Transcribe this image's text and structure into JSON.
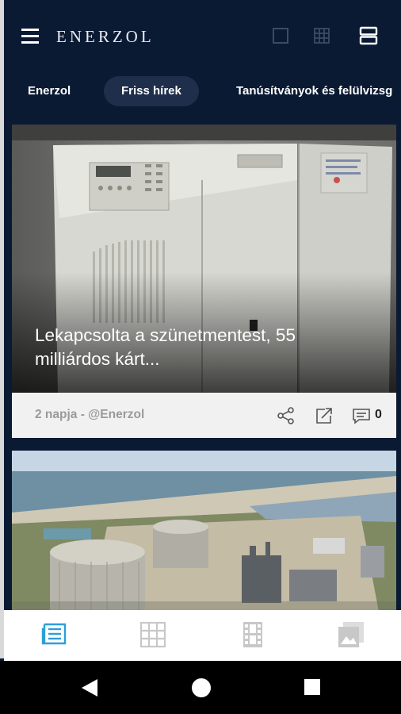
{
  "app": {
    "brand": "ENERZOL"
  },
  "header": {
    "view_modes": [
      "single-view-icon",
      "grid-view-icon",
      "list-view-icon"
    ],
    "colors": {
      "bar": "#0b1a33",
      "active_pill": "#1f2e4a",
      "accent": "#2e9fd8"
    }
  },
  "tabs": [
    {
      "label": "Enerzol",
      "active": false
    },
    {
      "label": "Friss hírek",
      "active": true
    },
    {
      "label": "Tanúsítványok és felülvizsg",
      "active": false
    }
  ],
  "articles": [
    {
      "title": "Lekapcsolta a szünetmentest, 55 milliárdos kárt...",
      "meta": "2 napja - @Enerzol",
      "comments": "0",
      "image": "ups-cabinet-photo"
    },
    {
      "title": "",
      "meta": "",
      "comments": "",
      "image": "lng-terminal-aerial-photo"
    }
  ],
  "bottom_nav": [
    {
      "icon": "news-icon",
      "active": true
    },
    {
      "icon": "grid-icon",
      "active": false
    },
    {
      "icon": "video-icon",
      "active": false
    },
    {
      "icon": "gallery-icon",
      "active": false
    }
  ],
  "system_nav": [
    "back-icon",
    "home-icon",
    "recents-icon"
  ]
}
